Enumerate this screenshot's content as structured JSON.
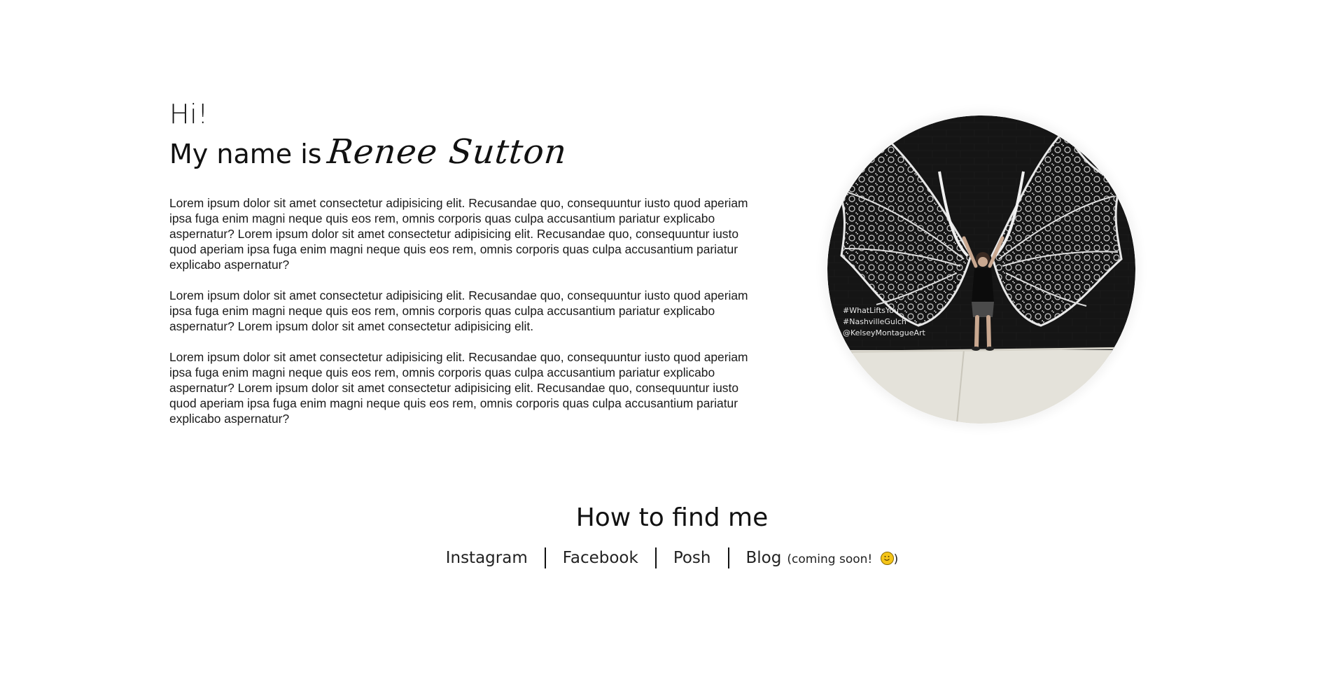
{
  "intro": {
    "greeting": "Hi!",
    "name_prefix": "My name is",
    "name": "Renee Sutton"
  },
  "bio": {
    "paragraphs": [
      "Lorem ipsum dolor sit amet consectetur adipisicing elit. Recusandae quo, consequuntur iusto quod aperiam ipsa fuga enim magni neque quis eos rem, omnis corporis quas culpa accusantium pariatur explicabo aspernatur? Lorem ipsum dolor sit amet consectetur adipisicing elit. Recusandae quo, consequuntur iusto quod aperiam ipsa fuga enim magni neque quis eos rem, omnis corporis quas culpa accusantium pariatur explicabo aspernatur?",
      "Lorem ipsum dolor sit amet consectetur adipisicing elit. Recusandae quo, consequuntur iusto quod aperiam ipsa fuga enim magni neque quis eos rem, omnis corporis quas culpa accusantium pariatur explicabo aspernatur? Lorem ipsum dolor sit amet consectetur adipisicing elit.",
      "Lorem ipsum dolor sit amet consectetur adipisicing elit. Recusandae quo, consequuntur iusto quod aperiam ipsa fuga enim magni neque quis eos rem, omnis corporis quas culpa accusantium pariatur explicabo aspernatur? Lorem ipsum dolor sit amet consectetur adipisicing elit. Recusandae quo, consequuntur iusto quod aperiam ipsa fuga enim magni neque quis eos rem, omnis corporis quas culpa accusantium pariatur explicabo aspernatur?"
    ]
  },
  "photo": {
    "mural_text": [
      "#WhatLiftsYou",
      "#NashvilleGulch",
      "@KelseyMontagueArt"
    ]
  },
  "find_me": {
    "title": "How to find me",
    "links": {
      "instagram": "Instagram",
      "facebook": "Facebook",
      "posh": "Posh",
      "blog": "Blog"
    },
    "blog_note": "(coming soon!",
    "blog_note_close": ")",
    "blog_note_icon": "smiley-icon"
  },
  "colors": {
    "text": "#111111",
    "background": "#ffffff",
    "mural_wall": "#1c1c1c",
    "sidewalk": "#e4e2da"
  }
}
